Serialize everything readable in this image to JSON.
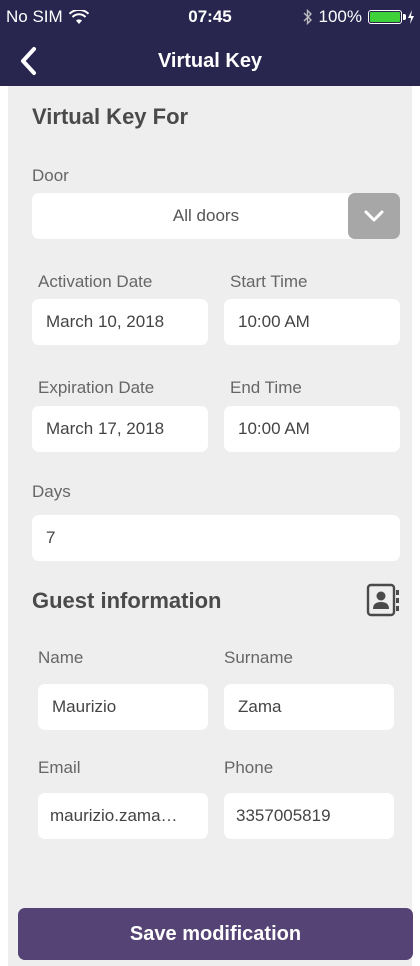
{
  "status_bar": {
    "carrier": "No SIM",
    "time": "07:45",
    "battery_percent": "100%",
    "battery_level": 1.0,
    "icons": [
      "wifi-icon",
      "bluetooth-icon",
      "battery-icon",
      "charging-icon"
    ]
  },
  "navbar": {
    "title": "Virtual Key",
    "back_icon": "chevron-left-icon"
  },
  "virtual_key": {
    "section_title": "Virtual Key For",
    "door_label": "Door",
    "door_value": "All doors",
    "activation_date_label": "Activation Date",
    "activation_date_value": "March 10, 2018",
    "start_time_label": "Start Time",
    "start_time_value": "10:00 AM",
    "expiration_date_label": "Expiration Date",
    "expiration_date_value": "March 17, 2018",
    "end_time_label": "End Time",
    "end_time_value": "10:00 AM",
    "days_label": "Days",
    "days_value": "7"
  },
  "guest": {
    "section_title": "Guest information",
    "name_label": "Name",
    "name_value": "Maurizio",
    "surname_label": "Surname",
    "surname_value": "Zama",
    "email_label": "Email",
    "email_value": "maurizio.zama…",
    "phone_label": "Phone",
    "phone_value": "3357005819"
  },
  "actions": {
    "save_label": "Save modification"
  },
  "colors": {
    "header_bg": "#28254f",
    "content_bg": "#efeeef",
    "button_bg": "#544374",
    "battery_fill": "#3fd13a"
  }
}
